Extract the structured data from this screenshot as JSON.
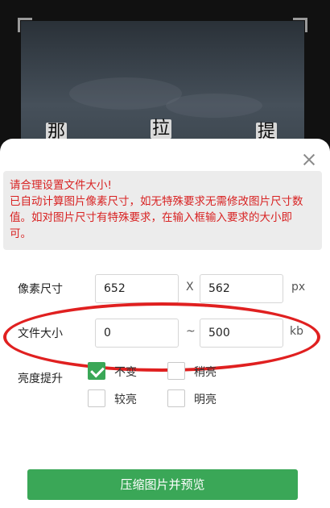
{
  "background": {
    "chars": [
      "那",
      "拉",
      "提"
    ]
  },
  "dialog": {
    "notice": {
      "title": "请合理设置文件大小!",
      "line2": "已自动计算图片像素尺寸，如无特殊要求无需修改图片尺寸数",
      "line3": "值。如对图片尺寸有特殊要求，在输入框输入要求的大小即",
      "line4": "可。"
    },
    "pixel_size": {
      "label": "像素尺寸",
      "width": "652",
      "separator": "X",
      "height": "562",
      "unit": "px"
    },
    "file_size": {
      "label": "文件大小",
      "min": "0",
      "separator": "~",
      "max": "500",
      "unit": "kb"
    },
    "brightness": {
      "label": "亮度提升",
      "options": [
        {
          "label": "不变",
          "checked": true
        },
        {
          "label": "稍亮",
          "checked": false
        },
        {
          "label": "较亮",
          "checked": false
        },
        {
          "label": "明亮",
          "checked": false
        }
      ]
    },
    "submit_label": "压缩图片并预览"
  },
  "colors": {
    "accent": "#3aa757",
    "notice_text": "#d82222",
    "annotation": "#e02020"
  }
}
